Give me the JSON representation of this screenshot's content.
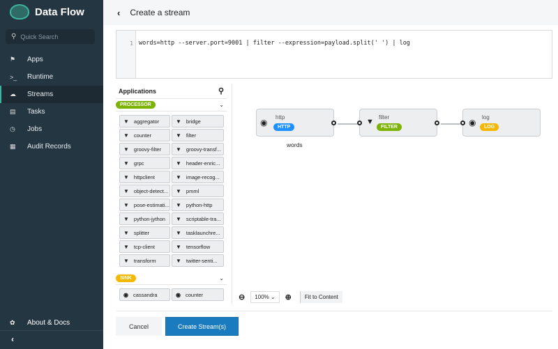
{
  "app": {
    "title": "Data Flow"
  },
  "sidebar": {
    "search_placeholder": "Quick Search",
    "items": [
      {
        "label": "Apps",
        "icon": "tags-icon"
      },
      {
        "label": "Runtime",
        "icon": "terminal-icon"
      },
      {
        "label": "Streams",
        "icon": "cloud-icon",
        "active": true
      },
      {
        "label": "Tasks",
        "icon": "tasks-icon"
      },
      {
        "label": "Jobs",
        "icon": "clock-icon"
      },
      {
        "label": "Audit Records",
        "icon": "list-icon"
      }
    ],
    "about": "About & Docs"
  },
  "header": {
    "title": "Create a stream"
  },
  "editor": {
    "line": "1",
    "code": "words=http --server.port=9001 | filter --expression=payload.split(' ') | log"
  },
  "applications": {
    "title": "Applications",
    "processor": {
      "label": "PROCESSOR",
      "color": "#7cb305",
      "items": [
        "aggregator",
        "bridge",
        "counter",
        "filter",
        "groovy-filter",
        "groovy-transf...",
        "grpc",
        "header-enric...",
        "httpclient",
        "image-recog...",
        "object-detect...",
        "pmml",
        "pose-estimati...",
        "python-http",
        "python-jython",
        "scriptable-tra...",
        "splitter",
        "tasklaunchre...",
        "tcp-client",
        "tensorflow",
        "transform",
        "twitter-senti..."
      ]
    },
    "sink": {
      "label": "SINK",
      "color": "#f5b800",
      "items": [
        "cassandra",
        "counter"
      ]
    }
  },
  "graph": {
    "stream_name": "words",
    "nodes": [
      {
        "name": "http",
        "badge": "HTTP",
        "color": "#1e90ff"
      },
      {
        "name": "filter",
        "badge": "FILTER",
        "color": "#7cb305"
      },
      {
        "name": "log",
        "badge": "LOG",
        "color": "#f5b800"
      }
    ]
  },
  "zoom": {
    "level": "100%",
    "fit": "Fit to Content"
  },
  "actions": {
    "cancel": "Cancel",
    "create": "Create Stream(s)"
  }
}
